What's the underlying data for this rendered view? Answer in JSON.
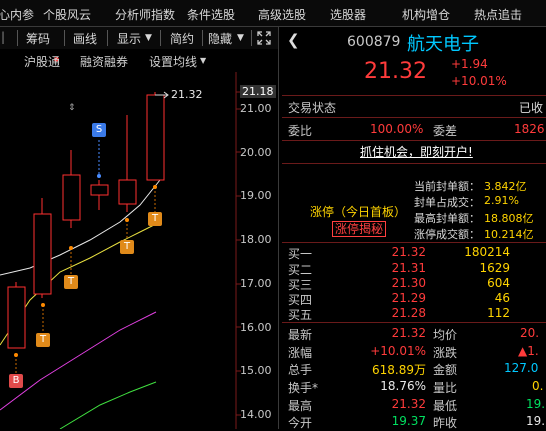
{
  "menu": [
    "心内参",
    "个股风云",
    "分析师指数",
    "条件选股",
    "高级选股",
    "选股器",
    "机构增仓",
    "热点追击"
  ],
  "toolbar": {
    "chip_label": "筹码",
    "draw_label": "画线",
    "display_label": "显示",
    "simple_label": "简约",
    "hide_label": "隐藏",
    "expand_icon": "expand-icon"
  },
  "subtoolbar": {
    "hgt_label": "沪股通",
    "margin_label": "融资融券",
    "ma_label": "设置均线"
  },
  "price_axis": [
    "21.18",
    "21.00",
    "20.00",
    "19.00",
    "18.00",
    "17.00",
    "16.00",
    "15.00",
    "14.00"
  ],
  "chart_annotations": {
    "high_price": "21.32",
    "markers": [
      "S",
      "T",
      "T",
      "T",
      "T",
      "B"
    ]
  },
  "stock": {
    "code": "600879",
    "name": "航天电子",
    "price": "21.32",
    "change": "+1.94",
    "change_pct": "+10.01%"
  },
  "trade_status": {
    "label": "交易状态",
    "value": "已收"
  },
  "ratio": {
    "weibi_label": "委比",
    "weibi_value": "100.00%",
    "weicha_label": "委差",
    "weicha_value": "1826"
  },
  "promo": "抓住机会，即刻开户!",
  "limit_up": {
    "title": "涨停（今日首板）",
    "button": "涨停揭秘",
    "rows": [
      {
        "label": "当前封单额：",
        "value": "3.842亿"
      },
      {
        "label": "封单占成交：",
        "value": "2.91%"
      },
      {
        "label": "最高封单额：",
        "value": "18.808亿"
      },
      {
        "label": "涨停成交额：",
        "value": "10.214亿"
      }
    ]
  },
  "order_book": [
    {
      "label": "买一",
      "price": "21.32",
      "volume": "180214"
    },
    {
      "label": "买二",
      "price": "21.31",
      "volume": "1629"
    },
    {
      "label": "买三",
      "price": "21.30",
      "volume": "604"
    },
    {
      "label": "买四",
      "price": "21.29",
      "volume": "46"
    },
    {
      "label": "买五",
      "price": "21.28",
      "volume": "112"
    }
  ],
  "stats": [
    {
      "l1": "最新",
      "v1": "21.32",
      "l2": "均价",
      "v2": "20."
    },
    {
      "l1": "涨幅",
      "v1": "+10.01%",
      "l2": "涨跌",
      "v2": "▲1."
    },
    {
      "l1": "总手",
      "v1": "618.89万",
      "l2": "金额",
      "v2": "127.0"
    },
    {
      "l1": "换手*",
      "v1": "18.76%",
      "l2": "量比",
      "v2": "0."
    },
    {
      "l1": "最高",
      "v1": "21.32",
      "l2": "最低",
      "v2": "19."
    },
    {
      "l1": "今开",
      "v1": "19.37",
      "l2": "昨收",
      "v2": "19."
    }
  ],
  "colors": {
    "up": "#ff3b3b",
    "down": "#00e060",
    "accent": "#00c8ff",
    "ma_yellow": "#ffd400",
    "ma_purple": "#e040e0"
  }
}
